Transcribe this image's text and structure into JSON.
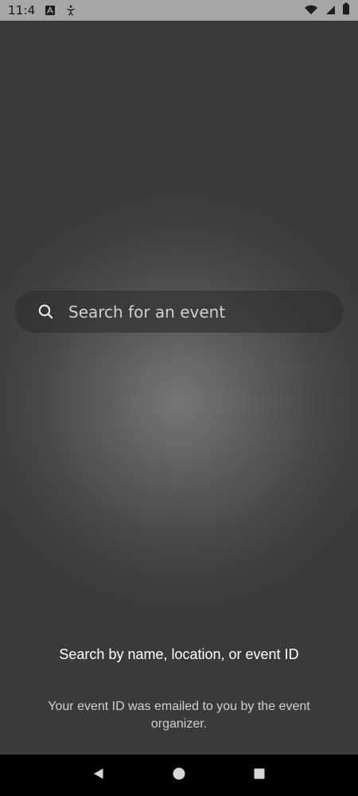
{
  "status_bar": {
    "time": "11:4",
    "icons": {
      "left": [
        "keyboard-app-icon",
        "accessibility-icon"
      ],
      "right": [
        "wifi-icon",
        "cellular-signal-icon",
        "battery-icon"
      ]
    }
  },
  "search": {
    "placeholder": "Search for an event",
    "value": ""
  },
  "help": {
    "title": "Search by name, location, or event ID",
    "subtitle": "Your event ID was emailed to you by the event organizer."
  },
  "navigation": {
    "back": "back-nav-icon",
    "home": "home-nav-icon",
    "recents": "recents-nav-icon"
  },
  "colors": {
    "status_bar_bg": "#a6a6a6",
    "text_primary": "#ffffff",
    "text_secondary": "#cfcfcf",
    "nav_bg": "#000000",
    "search_bg": "#2e2e2e"
  }
}
